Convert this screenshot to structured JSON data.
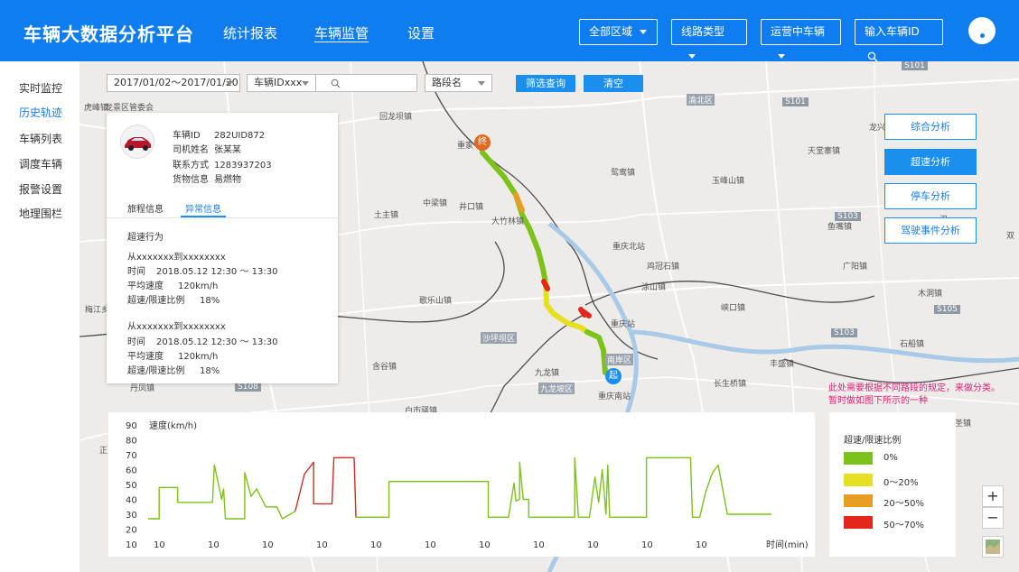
{
  "app": {
    "title": "车辆大数据分析平台"
  },
  "nav": [
    {
      "label": "统计报表",
      "active": false
    },
    {
      "label": "车辆监管",
      "active": true
    },
    {
      "label": "设置",
      "active": false
    }
  ],
  "toolbar": {
    "region": "全部区域",
    "route_type": "线路类型",
    "vehicle_status": "运营中车辆",
    "vehicle_id_placeholder": "输入车辆ID"
  },
  "sidebar": {
    "items": [
      {
        "label": "实时监控",
        "active": false
      },
      {
        "label": "历史轨迹",
        "active": true
      },
      {
        "label": "车辆列表",
        "active": false
      },
      {
        "label": "调度车辆",
        "active": false
      },
      {
        "label": "报警设置",
        "active": false
      },
      {
        "label": "地理围栏",
        "active": false
      }
    ]
  },
  "filters": {
    "date_range": "2017/01/02～2017/01/20",
    "vehicle_id": "车辆IDxxx",
    "search_value": "",
    "road_segment": "路段名",
    "query_button": "筛选查询",
    "clear_button": "清空"
  },
  "vehicle": {
    "rows": [
      {
        "label": "车辆ID",
        "value": "282UID872"
      },
      {
        "label": "司机姓名",
        "value": "张某某"
      },
      {
        "label": "联系方式",
        "value": "1283937203"
      },
      {
        "label": "货物信息",
        "value": "易燃物"
      }
    ],
    "tabs": [
      {
        "label": "旅程信息",
        "active": false
      },
      {
        "label": "异常信息",
        "active": true
      }
    ],
    "section_title": "超速行为",
    "events": [
      {
        "route": "从xxxxxxx到xxxxxxxx",
        "time_label": "时间",
        "time": "2018.05.12  12:30 ～ 13:30",
        "speed_label": "平均速度",
        "speed": "120km/h",
        "ratio_label": "超速/限速比例",
        "ratio": "18%"
      },
      {
        "route": "从xxxxxxx到xxxxxxxx",
        "time_label": "时间",
        "time": "2018.05.12  12:30 ～ 13:30",
        "speed_label": "平均速度",
        "speed": "120km/h",
        "ratio_label": "超速/限速比例",
        "ratio": "18%"
      }
    ]
  },
  "analysis_buttons": [
    {
      "label": "综合分析",
      "selected": false
    },
    {
      "label": "超速分析",
      "selected": true
    },
    {
      "label": "停车分析",
      "selected": false
    },
    {
      "label": "驾驶事件分析",
      "selected": false
    }
  ],
  "note": {
    "line1": "此处需要根据不同路段的规定，来做分类。",
    "line2": "暂时做如图下所示的一种"
  },
  "map": {
    "start_marker": "起",
    "end_marker": "终",
    "labels": [
      "龙景区管委会",
      "回龙坝镇",
      "重家",
      "井口镇",
      "中梁镇",
      "土主镇",
      "大竹林镇",
      "鸳鸯镇",
      "玉峰山镇",
      "天堂寨镇",
      "重庆北站",
      "鸡冠石镇",
      "涂山镇",
      "歌乐山镇",
      "重庆站",
      "沙坪坝区",
      "峡口镇",
      "广阳镇",
      "木洞镇",
      "梅江乡",
      "含谷镇",
      "九龙坡区",
      "九龙镇",
      "重庆南站",
      "南岸区",
      "长生桥镇",
      "丰盛镇",
      "丹凤镇",
      "白市驿镇",
      "虎峰镇",
      "渝北区",
      "龙兴",
      "鱼嘴镇",
      "石船镇",
      "汉",
      "双",
      "正",
      "二圣镇"
    ],
    "shields": [
      "S101",
      "S103",
      "S105",
      "S103",
      "S108",
      "S101"
    ],
    "zoom_in": "+",
    "zoom_out": "−"
  },
  "legend": {
    "title": "超速/限速比例",
    "items": [
      {
        "label": "0%",
        "color": "#7cc21b"
      },
      {
        "label": "0～20%",
        "color": "#e6e021"
      },
      {
        "label": "20～50%",
        "color": "#e79d24"
      },
      {
        "label": "50～70%",
        "color": "#e3271b"
      }
    ]
  },
  "chart_data": {
    "type": "line",
    "ylabel": "速度(km/h)",
    "xlabel": "时间(min)",
    "ylim": [
      10,
      90
    ],
    "y_ticks": [
      10,
      20,
      30,
      40,
      50,
      60,
      70,
      80,
      90
    ],
    "x_ticks": [
      "10",
      "10",
      "10",
      "10",
      "10",
      "10",
      "10",
      "10",
      "10",
      "10",
      "10"
    ],
    "series": [
      {
        "color": "#7cc21b",
        "values": [
          [
            0,
            27
          ],
          [
            12,
            27
          ],
          [
            12,
            48
          ],
          [
            32,
            48
          ],
          [
            32,
            38
          ],
          [
            70,
            38
          ],
          [
            72,
            63
          ],
          [
            80,
            40
          ],
          [
            82,
            47
          ],
          [
            84,
            27
          ],
          [
            105,
            27
          ],
          [
            105,
            58
          ],
          [
            112,
            42
          ],
          [
            118,
            47
          ],
          [
            128,
            35
          ],
          [
            140,
            35
          ],
          [
            146,
            27
          ],
          [
            160,
            32
          ]
        ]
      },
      {
        "color": "#c9302c",
        "values": [
          [
            160,
            32
          ],
          [
            170,
            57
          ],
          [
            180,
            65
          ],
          [
            180,
            37
          ],
          [
            200,
            37
          ],
          [
            202,
            68
          ],
          [
            224,
            68
          ],
          [
            226,
            28
          ]
        ]
      },
      {
        "color": "#7cc21b",
        "values": [
          [
            226,
            28
          ],
          [
            262,
            28
          ],
          [
            262,
            52
          ],
          [
            370,
            52
          ],
          [
            370,
            28
          ],
          [
            392,
            28
          ],
          [
            398,
            51
          ],
          [
            400,
            39
          ],
          [
            404,
            40
          ],
          [
            404,
            65
          ],
          [
            408,
            40
          ],
          [
            414,
            40
          ],
          [
            414,
            28
          ],
          [
            464,
            28
          ],
          [
            464,
            68
          ],
          [
            468,
            28
          ],
          [
            480,
            28
          ],
          [
            486,
            55
          ],
          [
            490,
            38
          ],
          [
            494,
            60
          ],
          [
            498,
            30
          ],
          [
            500,
            63
          ],
          [
            502,
            28
          ],
          [
            542,
            28
          ],
          [
            542,
            68
          ],
          [
            590,
            68
          ],
          [
            592,
            28
          ],
          [
            600,
            28
          ],
          [
            606,
            44
          ],
          [
            612,
            55
          ],
          [
            614,
            58
          ],
          [
            620,
            63
          ],
          [
            624,
            50
          ],
          [
            630,
            30
          ],
          [
            678,
            30
          ]
        ]
      }
    ]
  }
}
